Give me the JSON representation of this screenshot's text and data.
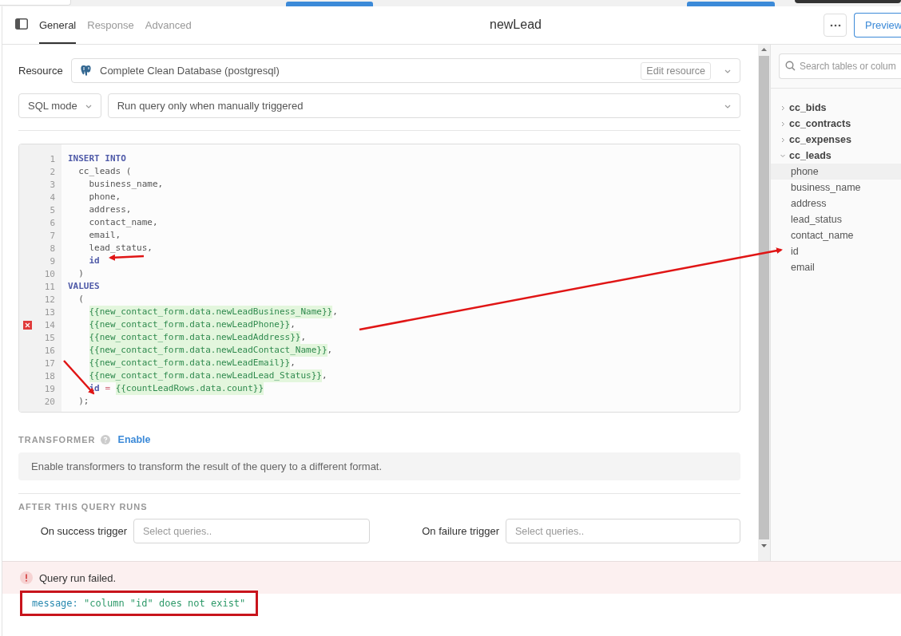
{
  "tabs": [
    {
      "label": "General",
      "selected": true
    },
    {
      "label": "Response",
      "selected": false
    },
    {
      "label": "Advanced",
      "selected": false
    }
  ],
  "title": "newLead",
  "preview_button": "Preview",
  "resource": {
    "label": "Resource",
    "value": "Complete Clean Database (postgresql)",
    "edit_button": "Edit resource"
  },
  "mode": {
    "value": "SQL mode"
  },
  "run_trigger": {
    "value": "Run query only when manually triggered"
  },
  "code": {
    "lines": [
      {
        "number": "1",
        "error": false,
        "tokens": [
          {
            "kind": "keyword",
            "text": "INSERT INTO"
          }
        ]
      },
      {
        "number": "2",
        "error": false,
        "tokens": [
          {
            "kind": "plain",
            "text": "  cc_leads ("
          }
        ]
      },
      {
        "number": "3",
        "error": false,
        "tokens": [
          {
            "kind": "plain",
            "text": "    business_name,"
          }
        ]
      },
      {
        "number": "4",
        "error": false,
        "tokens": [
          {
            "kind": "plain",
            "text": "    phone,"
          }
        ]
      },
      {
        "number": "5",
        "error": false,
        "tokens": [
          {
            "kind": "plain",
            "text": "    address,"
          }
        ]
      },
      {
        "number": "6",
        "error": false,
        "tokens": [
          {
            "kind": "plain",
            "text": "    contact_name,"
          }
        ]
      },
      {
        "number": "7",
        "error": false,
        "tokens": [
          {
            "kind": "plain",
            "text": "    email,"
          }
        ]
      },
      {
        "number": "8",
        "error": false,
        "tokens": [
          {
            "kind": "plain",
            "text": "    lead_status,"
          }
        ]
      },
      {
        "number": "9",
        "error": false,
        "tokens": [
          {
            "kind": "keyword",
            "text": "    id"
          }
        ]
      },
      {
        "number": "10",
        "error": false,
        "tokens": [
          {
            "kind": "plain",
            "text": "  )"
          }
        ]
      },
      {
        "number": "11",
        "error": false,
        "tokens": [
          {
            "kind": "keyword",
            "text": "VALUES"
          }
        ]
      },
      {
        "number": "12",
        "error": false,
        "tokens": [
          {
            "kind": "plain",
            "text": "  ("
          }
        ]
      },
      {
        "number": "13",
        "error": false,
        "tokens": [
          {
            "kind": "template",
            "text": "    {{new_contact_form.data.newLeadBusiness_Name}}"
          },
          {
            "kind": "plain",
            "text": ","
          }
        ]
      },
      {
        "number": "14",
        "error": true,
        "tokens": [
          {
            "kind": "template",
            "text": "    {{new_contact_form.data.newLeadPhone}}"
          },
          {
            "kind": "plain",
            "text": ","
          }
        ]
      },
      {
        "number": "15",
        "error": false,
        "tokens": [
          {
            "kind": "template",
            "text": "    {{new_contact_form.data.newLeadAddress}}"
          },
          {
            "kind": "plain",
            "text": ","
          }
        ]
      },
      {
        "number": "16",
        "error": false,
        "tokens": [
          {
            "kind": "template",
            "text": "    {{new_contact_form.data.newLeadContact_Name}}"
          },
          {
            "kind": "plain",
            "text": ","
          }
        ]
      },
      {
        "number": "17",
        "error": false,
        "tokens": [
          {
            "kind": "template",
            "text": "    {{new_contact_form.data.newLeadEmail}}"
          },
          {
            "kind": "plain",
            "text": ","
          }
        ]
      },
      {
        "number": "18",
        "error": false,
        "tokens": [
          {
            "kind": "template",
            "text": "    {{new_contact_form.data.newLeadLead_Status}}"
          },
          {
            "kind": "plain",
            "text": ","
          }
        ]
      },
      {
        "number": "19",
        "error": false,
        "tokens": [
          {
            "kind": "keyword",
            "text": "    id"
          },
          {
            "kind": "operator",
            "text": " = "
          },
          {
            "kind": "template",
            "text": "{{countLeadRows.data.count}}"
          }
        ]
      },
      {
        "number": "20",
        "error": false,
        "tokens": [
          {
            "kind": "plain",
            "text": "  );"
          }
        ]
      }
    ]
  },
  "transformer": {
    "heading": "TRANSFORMER",
    "link": "Enable",
    "description": "Enable transformers to transform the result of the query to a different format."
  },
  "after_run": {
    "heading": "AFTER THIS QUERY RUNS",
    "triggers": [
      {
        "label": "On success trigger",
        "placeholder": "Select queries.."
      },
      {
        "label": "On failure trigger",
        "placeholder": "Select queries.."
      }
    ]
  },
  "error": {
    "title": "Query run failed.",
    "message_key": "message:",
    "message_value": "\"column \"id\" does not exist\""
  },
  "schema": {
    "search_placeholder": "Search tables or colum",
    "tables": [
      {
        "name": "cc_bids",
        "expanded": false
      },
      {
        "name": "cc_contracts",
        "expanded": false
      },
      {
        "name": "cc_expenses",
        "expanded": false
      },
      {
        "name": "cc_leads",
        "expanded": true,
        "children": [
          {
            "name": "phone",
            "selected": true
          },
          {
            "name": "business_name",
            "selected": false
          },
          {
            "name": "address",
            "selected": false
          },
          {
            "name": "lead_status",
            "selected": false
          },
          {
            "name": "contact_name",
            "selected": false
          },
          {
            "name": "id",
            "selected": false
          },
          {
            "name": "email",
            "selected": false
          }
        ]
      }
    ]
  }
}
